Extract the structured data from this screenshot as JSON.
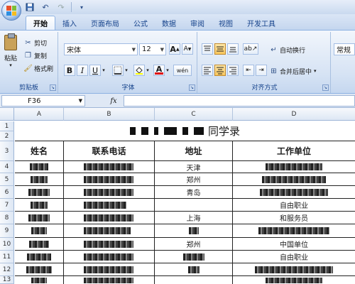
{
  "quick_access": {
    "save_icon": "save-icon",
    "undo_icon": "undo-icon",
    "redo_icon": "redo-icon",
    "customize_icon": "dropdown-icon"
  },
  "tabs": [
    "开始",
    "插入",
    "页面布局",
    "公式",
    "数据",
    "审阅",
    "视图",
    "开发工具"
  ],
  "ribbon": {
    "clipboard": {
      "paste": "粘贴",
      "cut": "剪切",
      "copy": "复制",
      "format_painter": "格式刷",
      "label": "剪贴板"
    },
    "font": {
      "font_name": "宋体",
      "font_size": "12",
      "grow": "A",
      "shrink": "A",
      "bold": "B",
      "italic": "I",
      "underline": "U",
      "font_color": "A",
      "phonetic": "wén",
      "label": "字体"
    },
    "alignment": {
      "wrap_text": "自动换行",
      "merge_center": "合并后居中",
      "label": "对齐方式"
    },
    "number": {
      "format": "常规"
    }
  },
  "formula_bar": {
    "name_box": "F36",
    "fx": "fx",
    "formula": ""
  },
  "columns": [
    "A",
    "B",
    "C",
    "D"
  ],
  "rows": [
    "1",
    "2",
    "3",
    "4",
    "5",
    "6",
    "7",
    "8",
    "9",
    "10",
    "11",
    "12",
    "13"
  ],
  "sheet": {
    "title_suffix": "同学录",
    "headers": {
      "name": "姓名",
      "phone": "联系电话",
      "address": "地址",
      "work_unit": "工作单位"
    },
    "rows": [
      {
        "address": "天津",
        "work": ""
      },
      {
        "address": "郑州",
        "work": ""
      },
      {
        "address": "青岛",
        "work": ""
      },
      {
        "address": "",
        "work": "自由职业"
      },
      {
        "address": "上海",
        "work": "和服务员"
      },
      {
        "address": "",
        "work": ""
      },
      {
        "address": "郑州",
        "work": "中国单位"
      },
      {
        "address": "",
        "work": "自由职业"
      },
      {
        "address": "",
        "work": ""
      },
      {
        "address": "",
        "work": ""
      }
    ]
  },
  "colors": {
    "ribbon_text": "#15428b",
    "grid_border": "#222222",
    "header_bg": "#dde7f4"
  }
}
